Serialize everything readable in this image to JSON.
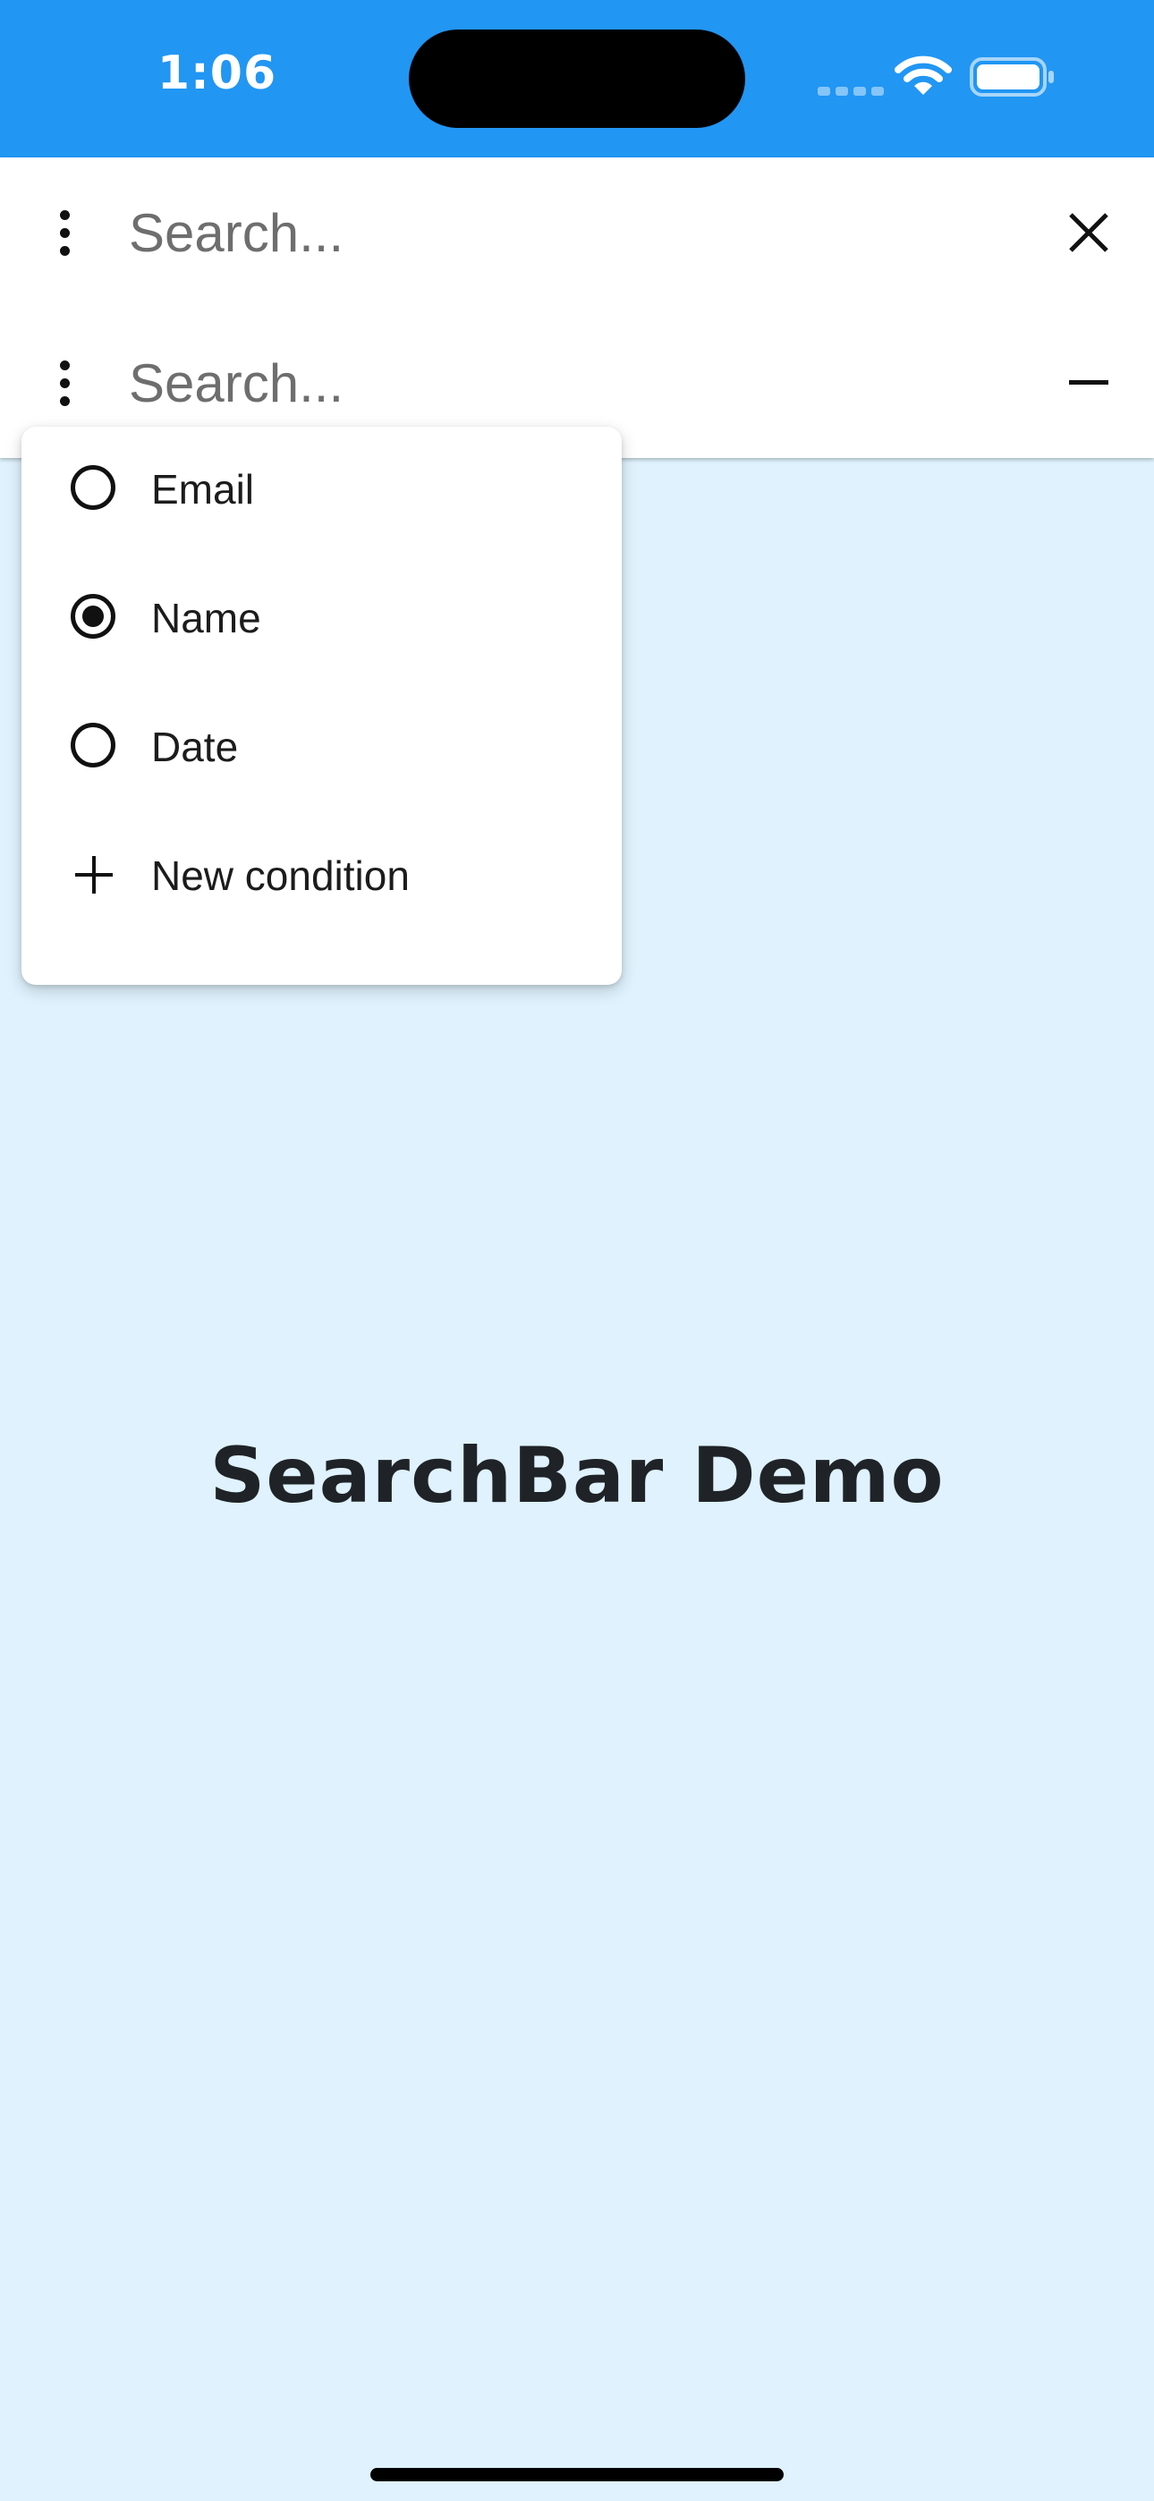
{
  "status_bar": {
    "time": "1:06",
    "background": "#2196f3"
  },
  "search_bars": [
    {
      "placeholder": "Search...",
      "action_icon": "close-icon"
    },
    {
      "placeholder": "Search...",
      "action_icon": "minus-icon"
    }
  ],
  "menu": {
    "items": [
      {
        "label": "Email",
        "type": "radio",
        "checked": false
      },
      {
        "label": "Name",
        "type": "radio",
        "checked": true
      },
      {
        "label": "Date",
        "type": "radio",
        "checked": false
      },
      {
        "label": "New condition",
        "type": "action",
        "icon": "plus-icon"
      }
    ]
  },
  "main": {
    "title": "SearchBar Demo",
    "background": "#dff2fd"
  }
}
